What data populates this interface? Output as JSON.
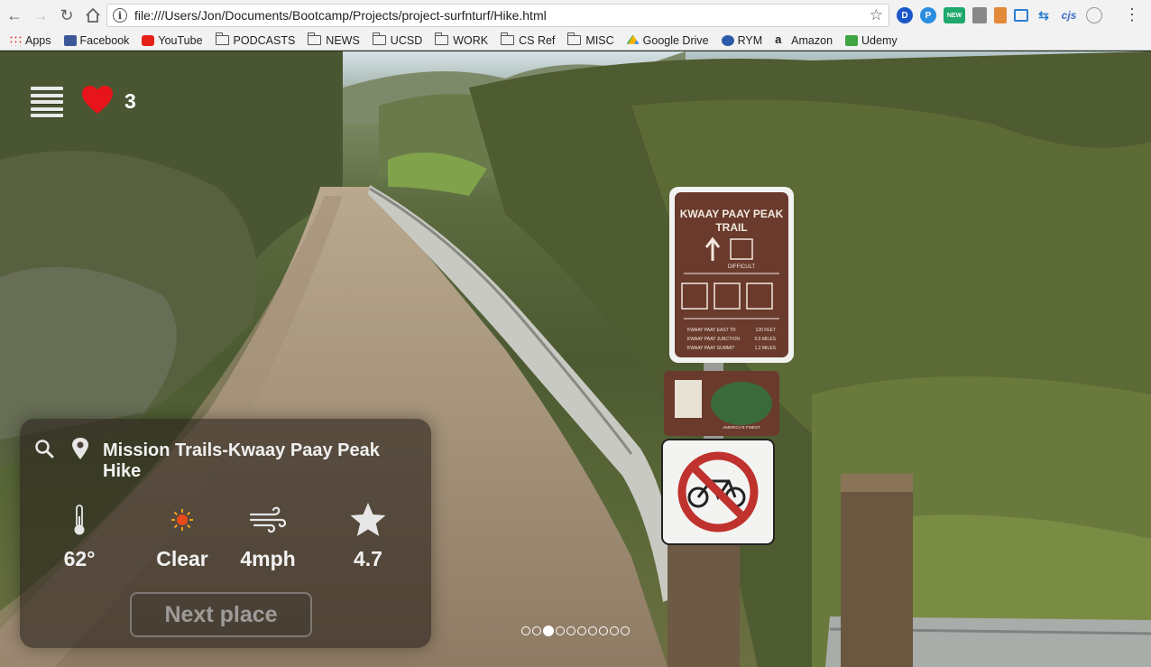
{
  "browser": {
    "url": "file:///Users/Jon/Documents/Bootcamp/Projects/project-surfnturf/Hike.html",
    "bookmarks": [
      {
        "label": "Apps",
        "icon": "apps-grid-icon"
      },
      {
        "label": "Facebook",
        "icon": "facebook-icon"
      },
      {
        "label": "YouTube",
        "icon": "youtube-icon"
      },
      {
        "label": "PODCASTS",
        "icon": "folder-icon"
      },
      {
        "label": "NEWS",
        "icon": "folder-icon"
      },
      {
        "label": "UCSD",
        "icon": "folder-icon"
      },
      {
        "label": "WORK",
        "icon": "folder-icon"
      },
      {
        "label": "CS Ref",
        "icon": "folder-icon"
      },
      {
        "label": "MISC",
        "icon": "folder-icon"
      },
      {
        "label": "Google Drive",
        "icon": "google-drive-icon"
      },
      {
        "label": "RYM",
        "icon": "rym-icon"
      },
      {
        "label": "Amazon",
        "icon": "amazon-icon"
      },
      {
        "label": "Udemy",
        "icon": "udemy-icon"
      }
    ],
    "extensions": {
      "d_label": "D",
      "p_label": "P",
      "new_label": "NEW",
      "cjs_label": "cjs"
    }
  },
  "app": {
    "likes": "3",
    "place_name": "Mission Trails-Kwaay Paay Peak Hike",
    "stats": {
      "temperature": "62°",
      "conditions": "Clear",
      "wind": "4mph",
      "rating": "4.7"
    },
    "next_button": "Next place",
    "carousel": {
      "count": 10,
      "active_index": 2
    },
    "colors": {
      "heart": "#e8141b",
      "panel": "#28221c",
      "sun": "#e84a1a"
    }
  },
  "scene_signs": {
    "trail_title_line1": "KWAAY PAAY PEAK",
    "trail_title_line2": "TRAIL",
    "difficulty": "DIFFICULT",
    "distances": [
      {
        "place": "KWAAY PAAY EAST TR",
        "dist": "120 FEET"
      },
      {
        "place": "KWAAY PAAY JUNCTION",
        "dist": "0.5 MILES"
      },
      {
        "place": "KWAAY PAAY SUMMIT",
        "dist": "1.2 MILES"
      }
    ],
    "emblem_text": "AMERICA'S FINEST"
  }
}
